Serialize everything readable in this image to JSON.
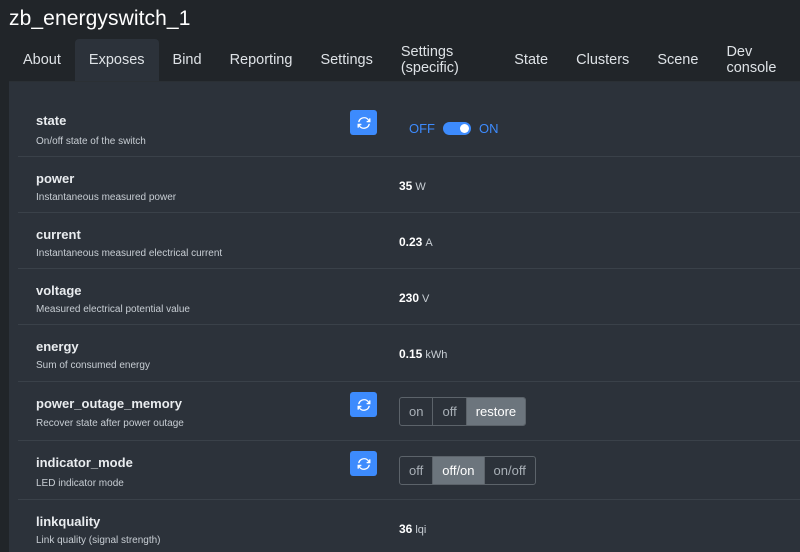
{
  "device": {
    "title": "zb_energyswitch_1"
  },
  "tabs": [
    {
      "label": "About"
    },
    {
      "label": "Exposes"
    },
    {
      "label": "Bind"
    },
    {
      "label": "Reporting"
    },
    {
      "label": "Settings"
    },
    {
      "label": "Settings (specific)"
    },
    {
      "label": "State"
    },
    {
      "label": "Clusters"
    },
    {
      "label": "Scene"
    },
    {
      "label": "Dev console"
    }
  ],
  "active_tab": "Exposes",
  "rows": {
    "state": {
      "name": "state",
      "desc": "On/off state of the switch",
      "off_label": "OFF",
      "on_label": "ON",
      "value": "ON"
    },
    "power": {
      "name": "power",
      "desc": "Instantaneous measured power",
      "value": "35",
      "unit": "W"
    },
    "current": {
      "name": "current",
      "desc": "Instantaneous measured electrical current",
      "value": "0.23",
      "unit": "A"
    },
    "voltage": {
      "name": "voltage",
      "desc": "Measured electrical potential value",
      "value": "230",
      "unit": "V"
    },
    "energy": {
      "name": "energy",
      "desc": "Sum of consumed energy",
      "value": "0.15",
      "unit": "kWh"
    },
    "power_outage_memory": {
      "name": "power_outage_memory",
      "desc": "Recover state after power outage",
      "options": [
        "on",
        "off",
        "restore"
      ],
      "selected": "restore"
    },
    "indicator_mode": {
      "name": "indicator_mode",
      "desc": "LED indicator mode",
      "options": [
        "off",
        "off/on",
        "on/off"
      ],
      "selected": "off/on"
    },
    "linkquality": {
      "name": "linkquality",
      "desc": "Link quality (signal strength)",
      "value": "36",
      "unit": "lqi"
    }
  },
  "colors": {
    "accent": "#3d8bfd",
    "background": "#212529",
    "panel": "#2c323a",
    "selected_option": "#6c757d"
  },
  "icons": {
    "refresh": "refresh-icon"
  }
}
